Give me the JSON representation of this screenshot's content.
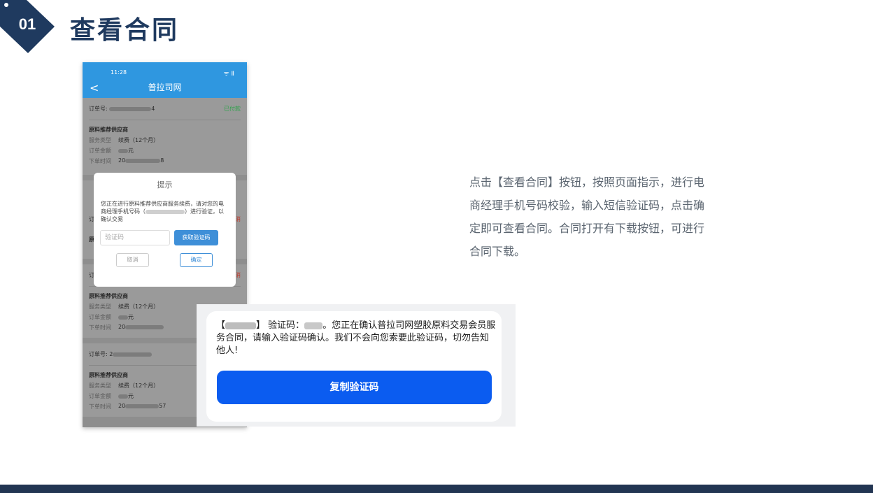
{
  "header": {
    "badge_number": "01",
    "title": "查看合同"
  },
  "phone": {
    "status_time": "11:28",
    "status_signal": "ᯤ Ⅱ",
    "nav_back": "<",
    "nav_title": "普拉司网",
    "orders": [
      {
        "order_label": "订单号:",
        "order_suffix": "4",
        "status": "已付款",
        "product": "原料推荐供应商",
        "service_type_label": "服务类型",
        "service_type": "续费（12个月）",
        "amount_label": "订单金额",
        "amount_suffix": "元",
        "time_label": "下单时间",
        "time_prefix": "20",
        "time_suffix": "8"
      },
      {
        "order_label": "订",
        "status": "消",
        "product": "原"
      },
      {
        "order_label": "订",
        "status": "消",
        "product": "原料推荐供应商",
        "service_type_label": "服务类型",
        "service_type": "续费（12个月）",
        "amount_label": "订单金额",
        "amount_suffix": "元",
        "time_label": "下单时间",
        "time_prefix": "20"
      },
      {
        "order_label": "订单号:",
        "order_prefix": "2",
        "product": "原料推荐供应商",
        "service_type_label": "服务类型",
        "service_type": "续费（12个月）",
        "amount_label": "订单金额",
        "amount_suffix": "元",
        "time_label": "下单时间",
        "time_prefix": "20",
        "time_suffix": "57"
      }
    ],
    "dialog": {
      "title": "提示",
      "message_a": "您正在进行原料推荐供应商服务续费，请对您的电商经理手机号码（",
      "message_b": "）进行验证，以确认交易",
      "input_placeholder": "验证码",
      "get_code": "获取验证码",
      "cancel": "取消",
      "confirm": "确定"
    }
  },
  "sms": {
    "bracket_open": "【",
    "bracket_close": "】",
    "code_label": "验证码：",
    "body": "。您正在确认普拉司网塑胶原料交易会员服务合同，请输入验证码确认。我们不会向您索要此验证码，切勿告知他人!",
    "copy_button": "复制验证码"
  },
  "description": "点击【查看合同】按钮，按照页面指示，进行电商经理手机号码校验，输入短信验证码，点击确定即可查看合同。合同打开有下载按钮，可进行合同下载。",
  "colors": {
    "brand_navy": "#1f3a5f",
    "phone_blue": "#2f97e0",
    "sms_button": "#0b5cf0",
    "footer": "#223552"
  }
}
